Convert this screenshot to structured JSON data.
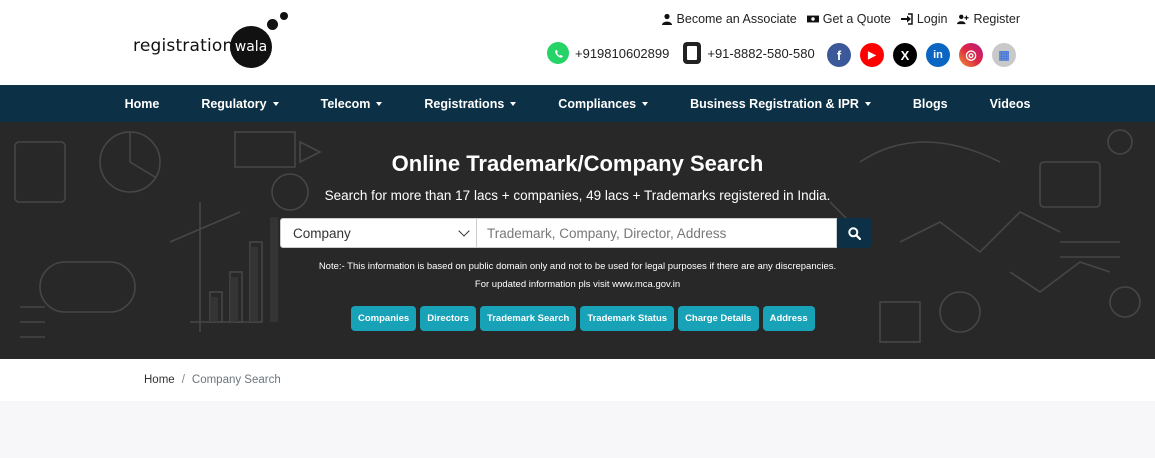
{
  "logo": {
    "word": "registration",
    "circle": "wala"
  },
  "top_links": [
    {
      "label": "Become an Associate",
      "icon": "user-icon"
    },
    {
      "label": "Get a Quote",
      "icon": "money-icon"
    },
    {
      "label": "Login",
      "icon": "login-icon"
    },
    {
      "label": "Register",
      "icon": "user-plus-icon"
    }
  ],
  "contact": {
    "whatsapp": "+919810602899",
    "phone": "+91-8882-580-580"
  },
  "social": [
    {
      "name": "facebook-icon",
      "glyph": "f",
      "color": "#3b5998"
    },
    {
      "name": "youtube-icon",
      "glyph": "▶",
      "color": "#ff0000"
    },
    {
      "name": "x-icon",
      "glyph": "X",
      "color": "#000000"
    },
    {
      "name": "linkedin-icon",
      "glyph": "in",
      "color": "#0a66c2"
    },
    {
      "name": "instagram-icon",
      "glyph": "◎",
      "color": "#d6249f"
    },
    {
      "name": "google-business-icon",
      "glyph": "▦",
      "color": "#c9c9c9"
    }
  ],
  "nav": [
    {
      "label": "Home",
      "dropdown": false
    },
    {
      "label": "Regulatory",
      "dropdown": true
    },
    {
      "label": "Telecom",
      "dropdown": true
    },
    {
      "label": "Registrations",
      "dropdown": true
    },
    {
      "label": "Compliances",
      "dropdown": true
    },
    {
      "label": "Business Registration & IPR",
      "dropdown": true
    },
    {
      "label": "Blogs",
      "dropdown": false
    },
    {
      "label": "Videos",
      "dropdown": false
    }
  ],
  "hero": {
    "title": "Online Trademark/Company Search",
    "subtitle": "Search for more than 17 lacs + companies, 49 lacs + Trademarks registered in India.",
    "select_value": "Company",
    "search_placeholder": "Trademark, Company, Director, Address",
    "note1": "Note:- This information is based on public domain only and not to be used for legal purposes if there are any discrepancies.",
    "note2": "For updated information pls visit www.mca.gov.in",
    "pills": [
      "Companies",
      "Directors",
      "Trademark Search",
      "Trademark Status",
      "Charge Details",
      "Address"
    ]
  },
  "breadcrumb": {
    "home": "Home",
    "separator": "/",
    "current": "Company Search"
  },
  "colors": {
    "nav_bg": "#0c3146",
    "pill_bg": "#17a2b8",
    "whatsapp": "#25d366"
  }
}
